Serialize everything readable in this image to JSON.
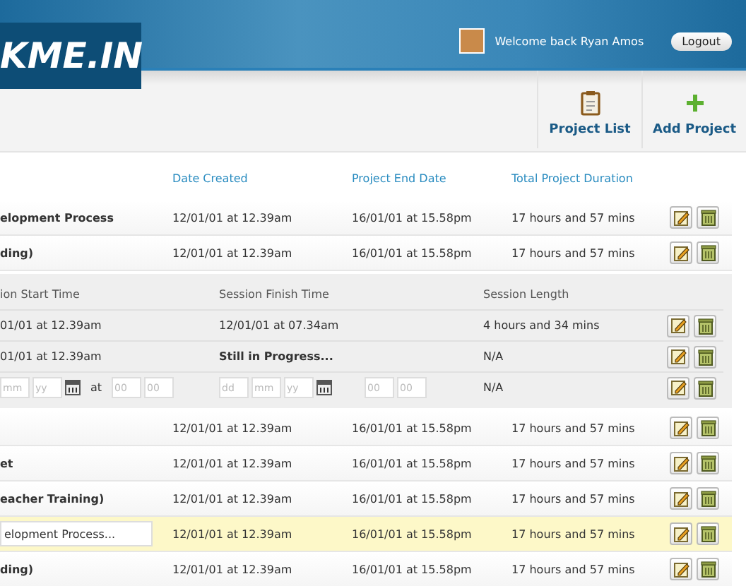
{
  "header": {
    "logo": "KME.IN",
    "welcome": "Welcome back Ryan Amos",
    "logout": "Logout"
  },
  "toolbar": [
    {
      "kind": "clipboard",
      "label": "Project List"
    },
    {
      "kind": "plus",
      "label": "Add Project"
    }
  ],
  "table": {
    "columns": [
      "Date Created",
      "Project End Date",
      "Total Project Duration"
    ],
    "rows": [
      {
        "kind": "text",
        "name": "elopment Process",
        "created": "12/01/01 at 12.39am",
        "end": "16/01/01 at 15.58pm",
        "duration": "17 hours and 57 mins",
        "selected": false
      },
      {
        "kind": "text",
        "name": "ding)",
        "created": "12/01/01 at 12.39am",
        "end": "16/01/01 at 15.58pm",
        "duration": "17 hours and 57 mins",
        "selected": false,
        "sessions": {
          "columns": [
            "ion Start Time",
            "Session Finish Time",
            "Session Length"
          ],
          "rows": [
            {
              "kind": "entry",
              "start": "01/01 at 12.39am",
              "finish": "12/01/01 at 07.34am",
              "finish_bold": false,
              "length": "4 hours and 34 mins"
            },
            {
              "kind": "entry",
              "start": "01/01 at 12.39am",
              "finish": "Still in Progress...",
              "finish_bold": true,
              "length": "N/A"
            },
            {
              "kind": "form",
              "start": {
                "date": [
                  {
                    "placeholder": "mm"
                  },
                  {
                    "placeholder": "yy"
                  }
                ],
                "at": "at",
                "time": [
                  {
                    "placeholder": "00"
                  },
                  {
                    "placeholder": "00"
                  }
                ]
              },
              "finish": {
                "date": [
                  {
                    "placeholder": "dd"
                  },
                  {
                    "placeholder": "mm"
                  },
                  {
                    "placeholder": "yy"
                  }
                ],
                "time": [
                  {
                    "placeholder": "00"
                  },
                  {
                    "placeholder": "00"
                  }
                ]
              },
              "length": "N/A"
            }
          ]
        }
      },
      {
        "kind": "text",
        "name": "",
        "created": "12/01/01 at 12.39am",
        "end": "16/01/01 at 15.58pm",
        "duration": "17 hours and 57 mins",
        "selected": false
      },
      {
        "kind": "text",
        "name": "et",
        "created": "12/01/01 at 12.39am",
        "end": "16/01/01 at 15.58pm",
        "duration": "17 hours and 57 mins",
        "selected": false
      },
      {
        "kind": "text",
        "name": "eacher Training)",
        "created": "12/01/01 at 12.39am",
        "end": "16/01/01 at 15.58pm",
        "duration": "17 hours and 57 mins",
        "selected": false
      },
      {
        "kind": "edit",
        "name": "elopment Process...",
        "created": "12/01/01 at 12.39am",
        "end": "16/01/01 at 15.58pm",
        "duration": "17 hours and 57 mins",
        "selected": true
      },
      {
        "kind": "text",
        "name": "ding)",
        "created": "12/01/01 at 12.39am",
        "end": "16/01/01 at 15.58pm",
        "duration": "17 hours and 57 mins",
        "selected": false
      }
    ]
  }
}
